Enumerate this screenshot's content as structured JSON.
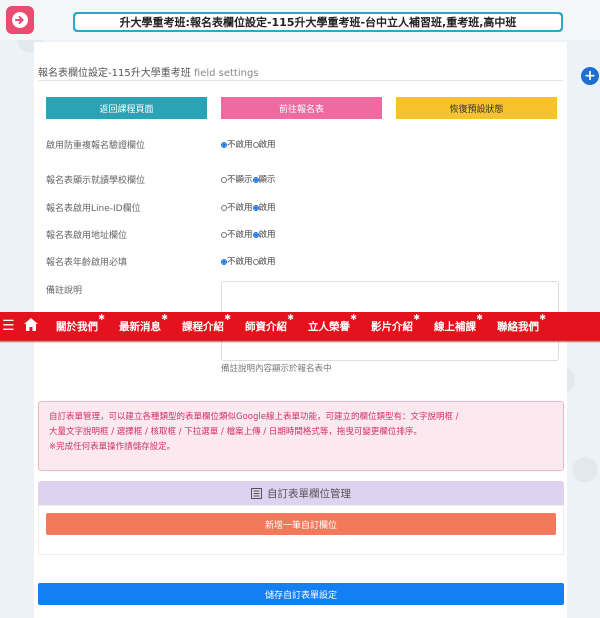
{
  "header": {
    "title": "升大學重考班:報名表欄位設定-115升大學重考班-台中立人補習班,重考班,高中班"
  },
  "section": {
    "title": "報名表欄位設定-115升大學重考班",
    "title_en": "field settings"
  },
  "actions": {
    "back_course": "返回課程頁面",
    "go_form": "前往報名表",
    "restore_default": "恢復預設狀態"
  },
  "settings": [
    {
      "label": "啟用防重複報名驗證欄位",
      "options": [
        "不啟用",
        "啟用"
      ],
      "selected": 0
    },
    {
      "label": "報名表顯示就讀學校欄位",
      "options": [
        "不顯示",
        "顯示"
      ],
      "selected": 1
    },
    {
      "label": "報名表啟用Line-ID欄位",
      "options": [
        "不啟用",
        "啟用"
      ],
      "selected": 1
    },
    {
      "label": "報名表啟用地址欄位",
      "options": [
        "不啟用",
        "啟用"
      ],
      "selected": 1
    },
    {
      "label": "報名表年齡啟用必填",
      "options": [
        "不啟用",
        "啟用"
      ],
      "selected": 0
    }
  ],
  "notes": {
    "label": "備註說明",
    "hint": "備註說明內容顯示於報名表中"
  },
  "nav": {
    "items": [
      "關於我們",
      "最新消息",
      "課程介紹",
      "師資介紹",
      "立人榮譽",
      "影片介紹",
      "線上補課",
      "聯絡我們"
    ]
  },
  "info": {
    "line1": "自訂表單管理，可以建立各種類型的表單欄位類似Google線上表單功能，可建立的欄位類型有：文字說明框 /",
    "line2": "大量文字說明框 / 選擇框 / 核取框 / 下拉選單 / 檔案上傳 / 日期時間格式等，拖曳可變更欄位排序。",
    "line3": "※完成任何表單操作請儲存設定。"
  },
  "custom_form": {
    "title": "自訂表單欄位管理",
    "add_button": "新增一筆自訂欄位",
    "save_button": "儲存自訂表單設定"
  },
  "colors": {
    "nav_red": "#e4121d",
    "title_teal": "#2aa9c7",
    "back_pink": "#ea4c72",
    "save_blue": "#147ff3"
  }
}
